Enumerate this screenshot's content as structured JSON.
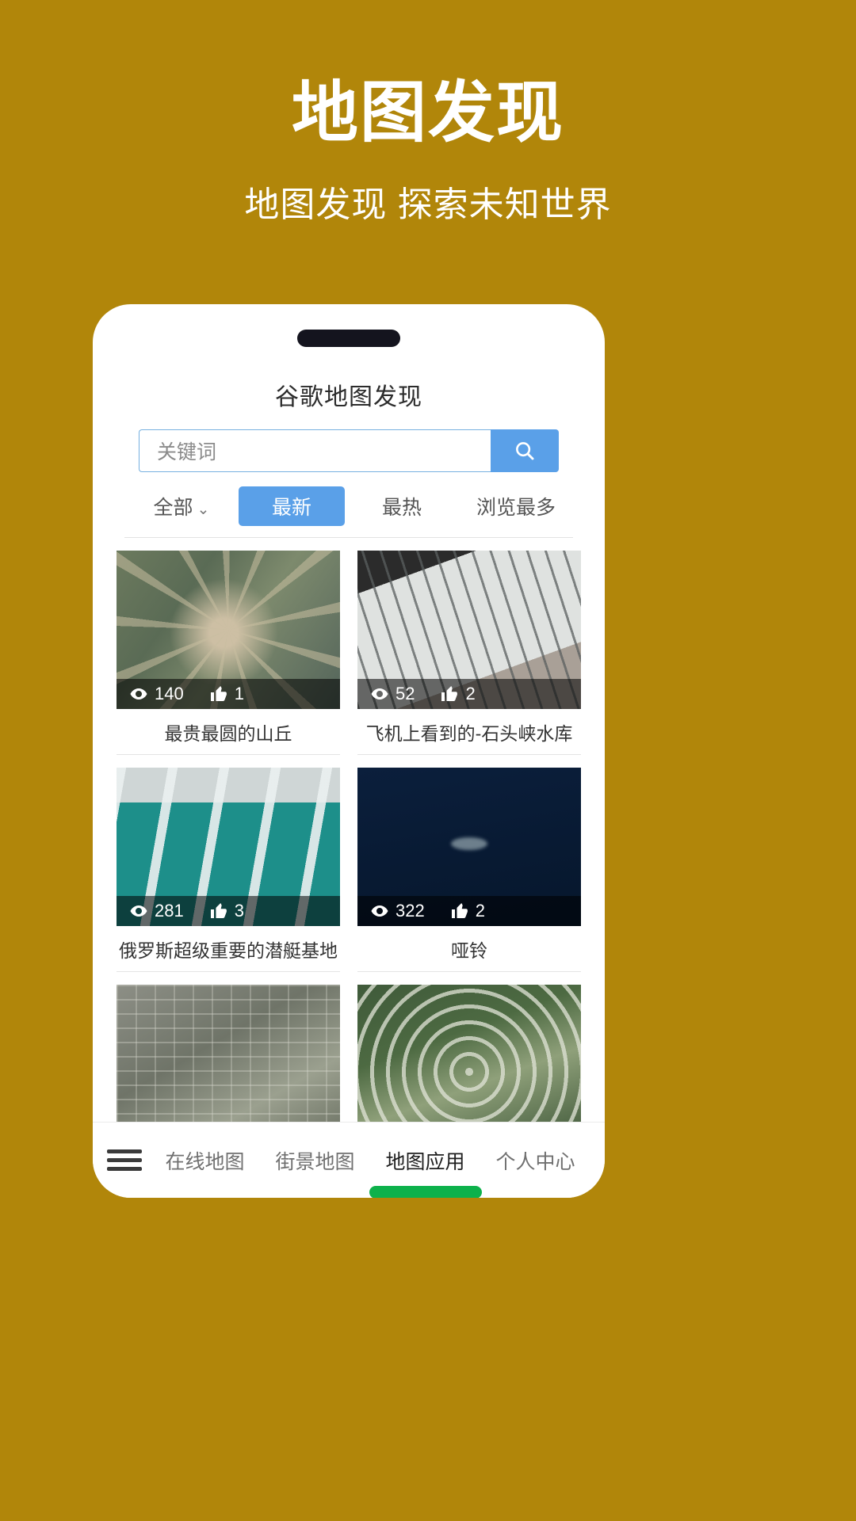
{
  "hero": {
    "title": "地图发现",
    "subtitle": "地图发现 探索未知世界",
    "background_color": "#b1860a",
    "text_color": "#ffffff"
  },
  "phone": {
    "app_title": "谷歌地图发现",
    "accent_color": "#5aa0e8",
    "nav_active_color": "#0db14b",
    "search": {
      "placeholder": "关键词",
      "value": "",
      "button_icon": "search-icon"
    },
    "filters": [
      {
        "label": "全部",
        "caret": "⌄",
        "active": false
      },
      {
        "label": "最新",
        "active": true
      },
      {
        "label": "最热",
        "active": false
      },
      {
        "label": "浏览最多",
        "active": false
      }
    ],
    "cards": [
      {
        "title": "最贵最圆的山丘",
        "views": "140",
        "likes": "1",
        "art": "art-1"
      },
      {
        "title": "飞机上看到的-石头峡水库",
        "views": "52",
        "likes": "2",
        "art": "art-2"
      },
      {
        "title": "俄罗斯超级重要的潜艇基地",
        "views": "281",
        "likes": "3",
        "art": "art-3"
      },
      {
        "title": "哑铃",
        "views": "322",
        "likes": "2",
        "art": "art-4"
      },
      {
        "title": "",
        "views": "",
        "likes": "",
        "art": "art-5"
      },
      {
        "title": "",
        "views": "",
        "likes": "",
        "art": "art-6"
      }
    ],
    "bottom_nav": {
      "menu_icon": "hamburger-icon",
      "items": [
        {
          "label": "在线地图",
          "active": false
        },
        {
          "label": "街景地图",
          "active": false
        },
        {
          "label": "地图应用",
          "active": true
        },
        {
          "label": "个人中心",
          "active": false
        }
      ]
    }
  }
}
